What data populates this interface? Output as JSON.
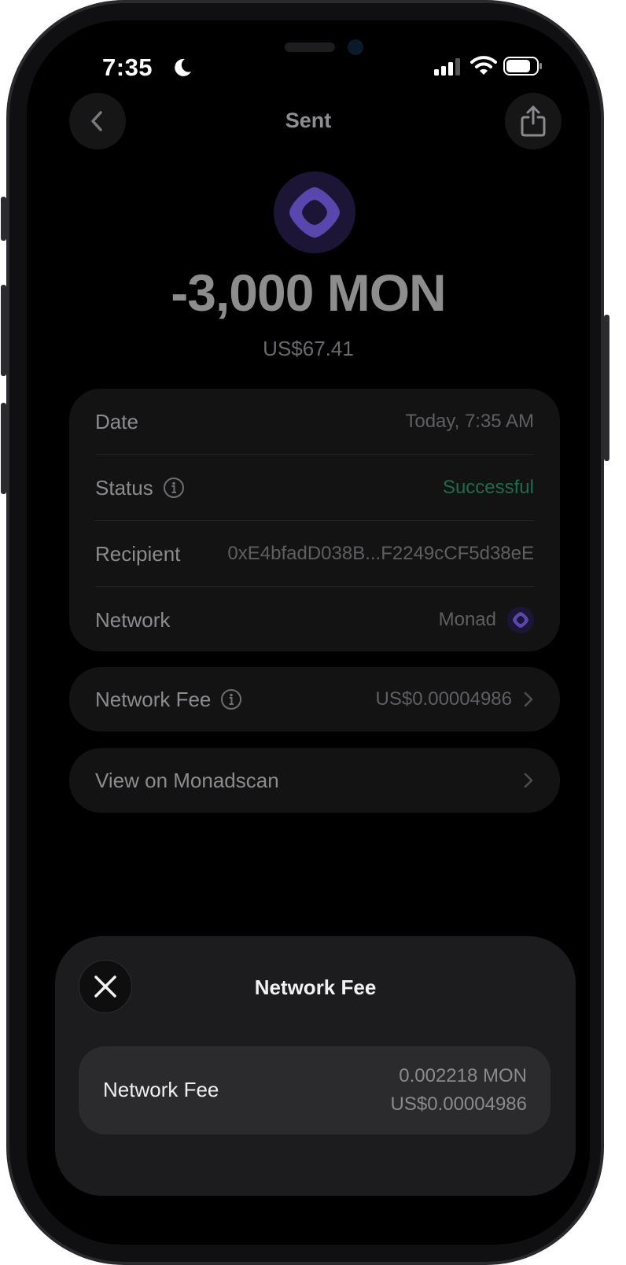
{
  "status_bar": {
    "time": "7:35"
  },
  "header": {
    "title": "Sent"
  },
  "transaction": {
    "amount": "-3,000 MON",
    "fiat": "US$67.41"
  },
  "details": {
    "date_label": "Date",
    "date_value": "Today, 7:35 AM",
    "status_label": "Status",
    "status_value": "Successful",
    "recipient_label": "Recipient",
    "recipient_value": "0xE4bfadD038B...F2249cCF5d38eE",
    "network_label": "Network",
    "network_value": "Monad"
  },
  "fee_row": {
    "label": "Network Fee",
    "value": "US$0.00004986"
  },
  "explorer_row": {
    "label": "View on Monadscan"
  },
  "sheet": {
    "title": "Network Fee",
    "fee_label": "Network Fee",
    "fee_crypto": "0.002218 MON",
    "fee_fiat": "US$0.00004986"
  },
  "colors": {
    "accent": "#6b55c8",
    "success": "#1d6d4d",
    "background": "#000000"
  },
  "icons": [
    "moon-icon",
    "signal-icon",
    "wifi-icon",
    "battery-icon",
    "back-icon",
    "share-icon",
    "monad-logo-icon",
    "info-icon",
    "chevron-right-icon",
    "close-icon"
  ]
}
